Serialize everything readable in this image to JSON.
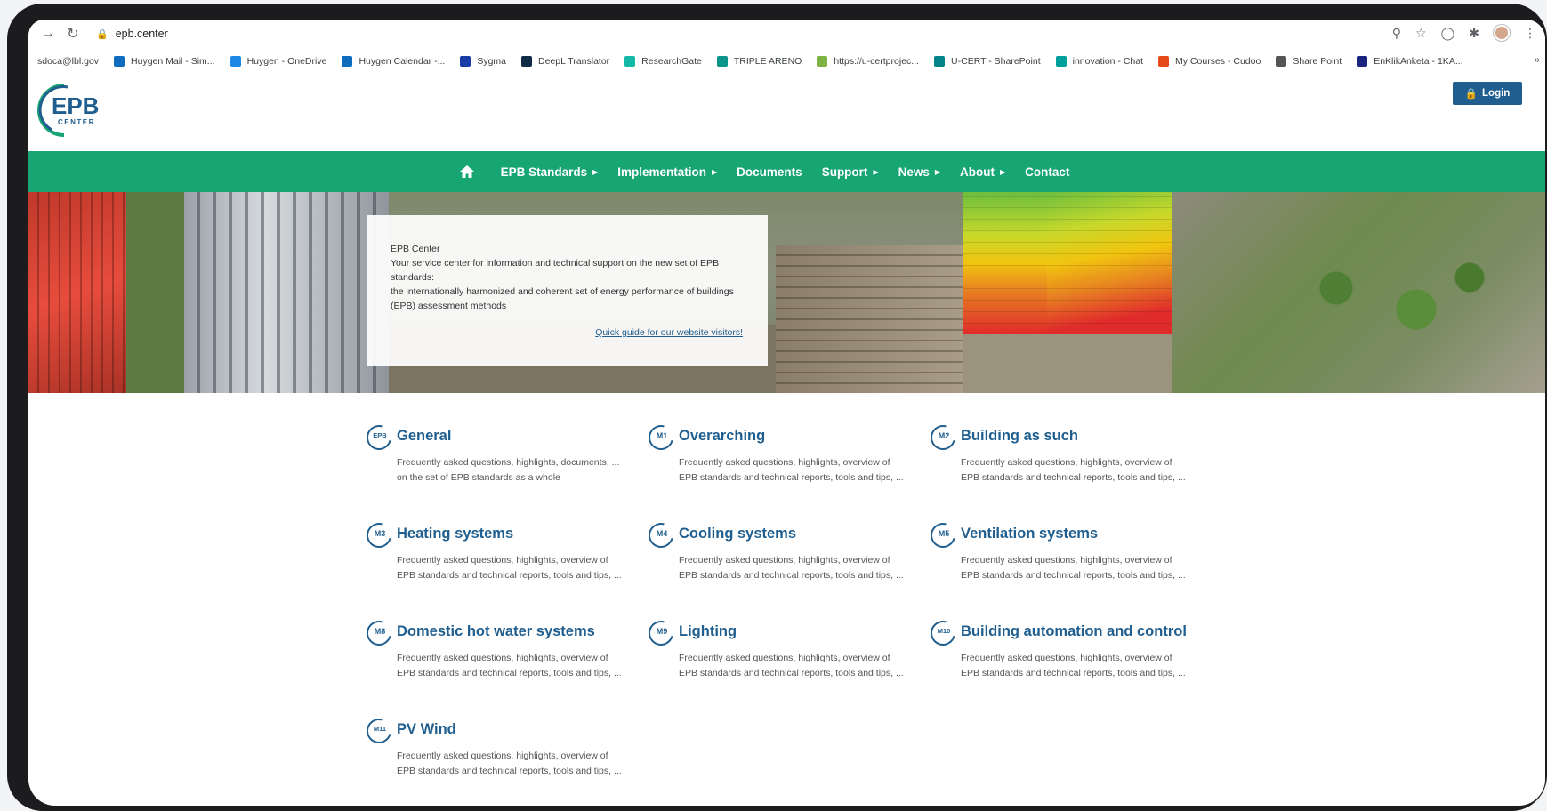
{
  "browser": {
    "url": "epb.center",
    "bookmarks": [
      {
        "label": "sdoca@lbl.gov",
        "color": "#ffffff"
      },
      {
        "label": "Huygen Mail - Sim...",
        "color": "#0f6cbd"
      },
      {
        "label": "Huygen - OneDrive",
        "color": "#1e88e5"
      },
      {
        "label": "Huygen Calendar -...",
        "color": "#0f6cbd"
      },
      {
        "label": "Sygma",
        "color": "#1a3ca6"
      },
      {
        "label": "DeepL Translator",
        "color": "#0f2b46"
      },
      {
        "label": "ResearchGate",
        "color": "#14b8a6"
      },
      {
        "label": "TRIPLE ARENO",
        "color": "#0d9488"
      },
      {
        "label": "https://u-certprojec...",
        "color": "#7cb342"
      },
      {
        "label": "U-CERT - SharePoint",
        "color": "#038387"
      },
      {
        "label": "innovation - Chat",
        "color": "#00a19a"
      },
      {
        "label": "My Courses - Cudoo",
        "color": "#e64a19"
      },
      {
        "label": "Share Point",
        "color": "#555555"
      },
      {
        "label": "EnKlikAnketa - 1KA...",
        "color": "#1a237e"
      }
    ]
  },
  "site": {
    "logo_text": "EPB",
    "logo_sub": "CENTER",
    "login_label": "Login",
    "nav": [
      {
        "label": "EPB Standards",
        "caret": true
      },
      {
        "label": "Implementation",
        "caret": true
      },
      {
        "label": "Documents",
        "caret": false
      },
      {
        "label": "Support",
        "caret": true
      },
      {
        "label": "News",
        "caret": true
      },
      {
        "label": "About",
        "caret": true
      },
      {
        "label": "Contact",
        "caret": false
      }
    ],
    "hero": {
      "title": "EPB Center",
      "line1": "Your service center for information and technical support on the new set of EPB standards:",
      "line2": "the internationally harmonized and coherent set of energy performance of buildings (EPB) assessment methods",
      "guide_link": "Quick guide for our website visitors!"
    },
    "categories": [
      {
        "badge": "EPB",
        "title": "General",
        "desc": "Frequently asked questions, highlights, documents, ... on the set of EPB standards as a whole"
      },
      {
        "badge": "M1",
        "title": "Overarching",
        "desc": "Frequently asked questions, highlights, overview of EPB standards and technical reports, tools and tips, ..."
      },
      {
        "badge": "M2",
        "title": "Building as such",
        "desc": "Frequently asked questions, highlights, overview of EPB standards and technical reports, tools and tips, ..."
      },
      {
        "badge": "M3",
        "title": "Heating systems",
        "desc": "Frequently asked questions, highlights, overview of EPB standards and technical reports, tools and tips, ..."
      },
      {
        "badge": "M4",
        "title": "Cooling systems",
        "desc": "Frequently asked questions, highlights, overview of EPB standards and technical reports, tools and tips, ..."
      },
      {
        "badge": "M5",
        "title": "Ventilation systems",
        "desc": "Frequently asked questions, highlights, overview of EPB standards and technical reports, tools and tips, ..."
      },
      {
        "badge": "M8",
        "title": "Domestic hot water systems",
        "desc": "Frequently asked questions, highlights, overview of EPB standards and technical reports, tools and tips, ..."
      },
      {
        "badge": "M9",
        "title": "Lighting",
        "desc": "Frequently asked questions, highlights, overview of EPB standards and technical reports, tools and tips, ..."
      },
      {
        "badge": "M10",
        "title": "Building automation and control",
        "desc": "Frequently asked questions, highlights, overview of EPB standards and technical reports, tools and tips, ..."
      },
      {
        "badge": "M11",
        "title": "PV Wind",
        "desc": "Frequently asked questions, highlights, overview of EPB standards and technical reports, tools and tips, ..."
      }
    ]
  },
  "colors": {
    "brand_green": "#17a673",
    "brand_blue": "#1f5e8e"
  }
}
